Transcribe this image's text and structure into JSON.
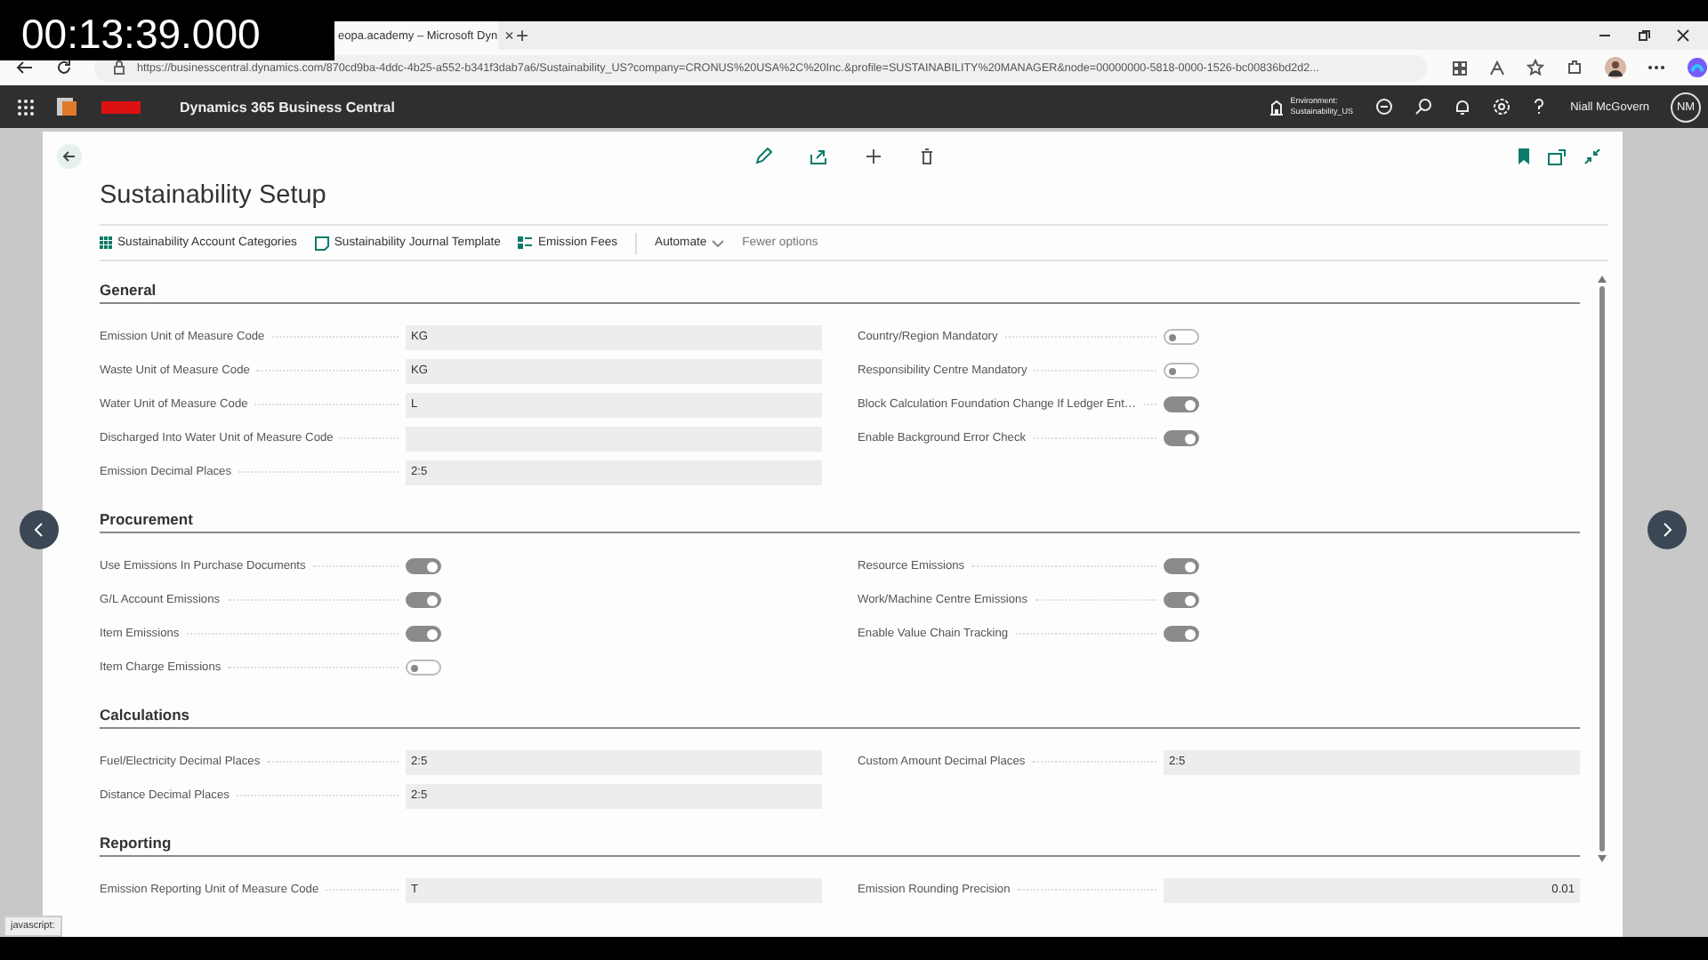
{
  "video": {
    "timestamp": "00:13:39.000"
  },
  "browser": {
    "tab_title": "eopa.academy – Microsoft Dyn",
    "tab_close": "×",
    "new_tab": "+",
    "url": "https://businesscentral.dynamics.com/870cd9ba-4ddc-4b25-a552-b341f3dab7a6/Sustainability_US?company=CRONUS%20USA%2C%20Inc.&profile=SUSTAINABILITY%20MANAGER&node=00000000-5818-0000-1526-bc00836bd2d2..."
  },
  "app_bar": {
    "product": "Dynamics 365 Business Central",
    "environment_label": "Environment:",
    "environment": "Sustainability_US",
    "user": "Niall McGovern",
    "initials": "NM"
  },
  "page": {
    "title": "Sustainability Setup",
    "actions": [
      {
        "label": "Sustainability Account Categories",
        "kind": "categories"
      },
      {
        "label": "Sustainability Journal Template",
        "kind": "template"
      },
      {
        "label": "Emission Fees",
        "kind": "fees"
      },
      {
        "label": "Automate",
        "kind": "menu"
      },
      {
        "label": "Fewer options",
        "kind": "plain"
      }
    ],
    "sections": [
      {
        "title": "General",
        "left": [
          {
            "label": "Emission Unit of Measure Code",
            "kind": "text",
            "value": "KG"
          },
          {
            "label": "Waste Unit of Measure Code",
            "kind": "text",
            "value": "KG"
          },
          {
            "label": "Water Unit of Measure Code",
            "kind": "text",
            "value": "L"
          },
          {
            "label": "Discharged Into Water Unit of Measure Code",
            "kind": "text"
          },
          {
            "label": "Emission Decimal Places",
            "kind": "text",
            "value": "2:5"
          }
        ],
        "right": [
          {
            "label": "Country/Region Mandatory",
            "kind": "toggle",
            "on": false
          },
          {
            "label": "Responsibility Centre Mandatory",
            "kind": "toggle",
            "on": false
          },
          {
            "label": "Block Calculation Foundation Change If Ledger Ent…",
            "kind": "toggle",
            "on": true
          },
          {
            "label": "Enable Background Error Check",
            "kind": "toggle",
            "on": true
          }
        ]
      },
      {
        "title": "Procurement",
        "left": [
          {
            "label": "Use Emissions In Purchase Documents",
            "kind": "toggle",
            "on": true
          },
          {
            "label": "G/L Account Emissions",
            "kind": "toggle",
            "on": true
          },
          {
            "label": "Item Emissions",
            "kind": "toggle",
            "on": true
          },
          {
            "label": "Item Charge Emissions",
            "kind": "toggle",
            "on": false
          }
        ],
        "right": [
          {
            "label": "Resource Emissions",
            "kind": "toggle",
            "on": true
          },
          {
            "label": "Work/Machine Centre Emissions",
            "kind": "toggle",
            "on": true
          },
          {
            "label": "Enable Value Chain Tracking",
            "kind": "toggle",
            "on": true
          }
        ]
      },
      {
        "title": "Calculations",
        "left": [
          {
            "label": "Fuel/Electricity Decimal Places",
            "kind": "text",
            "value": "2:5"
          },
          {
            "label": "Distance Decimal Places",
            "kind": "text",
            "value": "2:5"
          }
        ],
        "right": [
          {
            "label": "Custom Amount Decimal Places",
            "kind": "text",
            "value": "2:5"
          }
        ]
      },
      {
        "title": "Reporting",
        "left": [
          {
            "label": "Emission Reporting Unit of Measure Code",
            "kind": "text",
            "value": "T"
          }
        ],
        "right": [
          {
            "label": "Emission Rounding Precision",
            "kind": "number",
            "value": "0.01"
          }
        ]
      }
    ]
  },
  "status_bar": {
    "text": "javascript:"
  }
}
